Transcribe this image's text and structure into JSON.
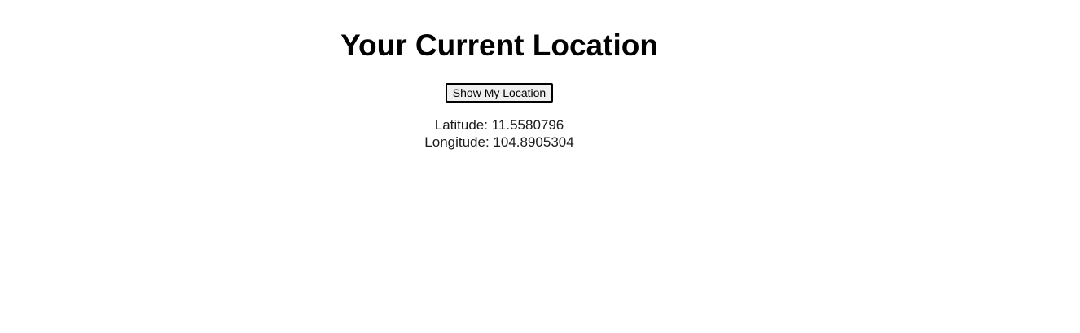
{
  "page": {
    "title": "Your Current Location"
  },
  "button": {
    "label": "Show My Location"
  },
  "location": {
    "latitude_label": "Latitude:",
    "latitude": "11.5580796",
    "longitude_label": "Longitude:",
    "longitude": "104.8905304"
  }
}
